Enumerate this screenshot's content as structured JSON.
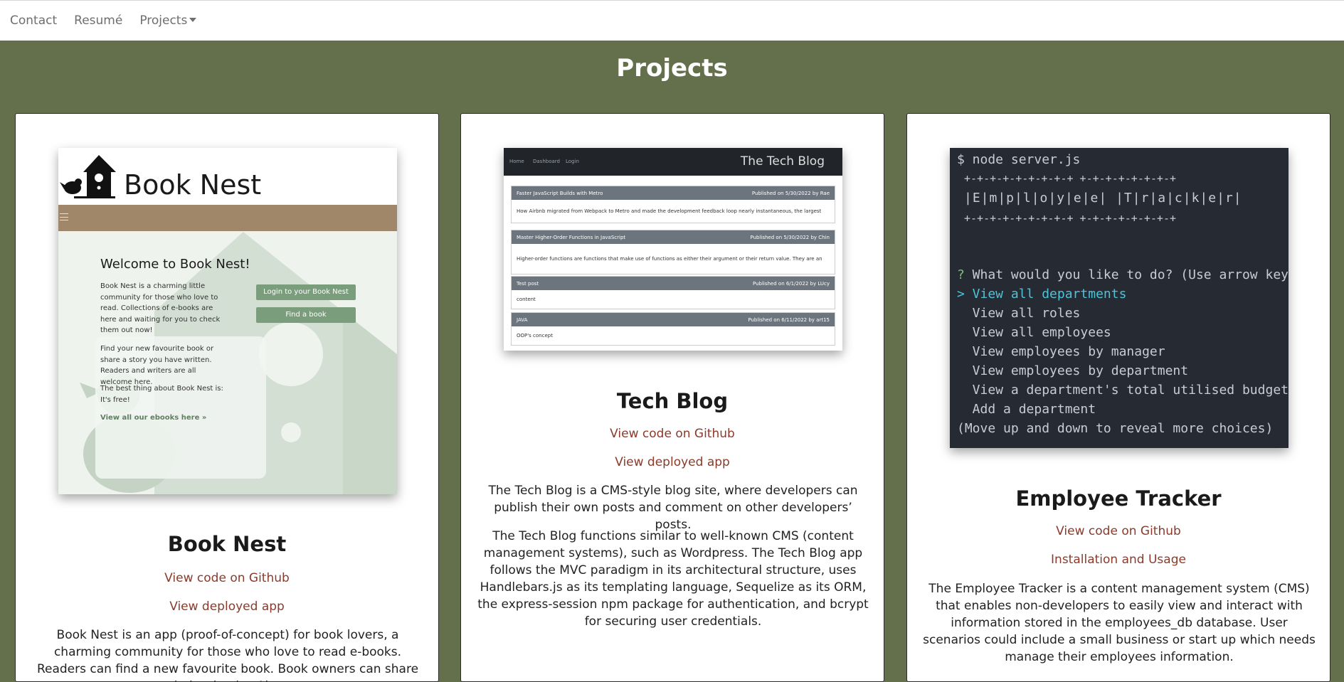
{
  "nav": {
    "contact": "Contact",
    "resume": "Resumé",
    "projects": "Projects"
  },
  "page": {
    "title": "Projects"
  },
  "colors": {
    "background": "#646f4b",
    "link": "#8b3a2b"
  },
  "cards": [
    {
      "title": "Book Nest",
      "github": "View code on Github",
      "deployed": "View deployed app",
      "description": "Book Nest is an app (proof-of-concept) for book lovers, a charming community for those who love to read e-books. Readers can find a new favourite book. Book owners can share their e-books. Also,",
      "shot": {
        "brand": "Book Nest",
        "welcome": "Welcome to Book Nest!",
        "p1": "Book Nest is a charming little community for those who love to read. Collections of e-books are here and waiting for you to check them out now!",
        "p2": "Find your new favourite book or share a story you have written. Readers and writers are all welcome here.",
        "p3": "The best thing about Book Nest is: It's free!",
        "link": "View all our ebooks here »",
        "btn_login": "Login to your Book Nest",
        "btn_find": "Find a book"
      }
    },
    {
      "title": "Tech Blog",
      "github": "View code on Github",
      "deployed": "View deployed app",
      "description1": "The Tech Blog is a CMS-style blog site, where developers can publish their own posts and comment on other developers’ posts.",
      "description2": "The Tech Blog functions similar to well-known CMS (content management systems), such as Wordpress. The Tech Blog app follows the MVC paradigm in its architectural structure, uses Handlebars.js as its templating language, Sequelize as its ORM, the express-session npm package for authentication, and bcrypt for securing user credentials.",
      "shot": {
        "nav_home": "Home",
        "nav_dashboard": "Dashboard",
        "nav_login": "Login",
        "brand": "The Tech Blog",
        "posts": [
          {
            "title": "Faster JavaScript Builds with Metro",
            "meta": "Published on 5/30/2022 by Rae",
            "body": "How Airbnb migrated from Webpack to Metro and made the development feedback loop nearly instantaneous, the largest"
          },
          {
            "title": "Master Higher-Order Functions in JavaScript",
            "meta": "Published on 5/30/2022 by Chin",
            "body": "Higher-order functions are functions that make use of functions as either their argument or their return value. They are an"
          },
          {
            "title": "Test post",
            "meta": "Published on 6/1/2022 by LUcy",
            "body": "content"
          },
          {
            "title": "JAVA",
            "meta": "Published on 6/11/2022 by art15",
            "body": "OOP's concept"
          }
        ]
      }
    },
    {
      "title": "Employee Tracker",
      "github": "View code on Github",
      "install": "Installation and Usage",
      "description": "The Employee Tracker is a content management system (CMS) that enables non-developers to easily view and interact with information stored in the employees_db database. User scenarios could include a small business or start up which needs manage their employees information.",
      "shot": {
        "cmd": "$ node server.js",
        "banner_border": "+-+-+-+-+-+-+-+-+ +-+-+-+-+-+-+-+",
        "banner": "|E|m|p|l|o|y|e|e| |T|r|a|c|k|e|r|",
        "prompt_mark": "?",
        "prompt": " What would you like to do? (Use arrow keys",
        "selected": "> View all departments",
        "options": [
          "  View all roles",
          "  View all employees",
          "  View employees by manager",
          "  View employees by department",
          "  View a department's total utilised budget",
          "  Add a department"
        ],
        "hint": "(Move up and down to reveal more choices)"
      }
    }
  ]
}
